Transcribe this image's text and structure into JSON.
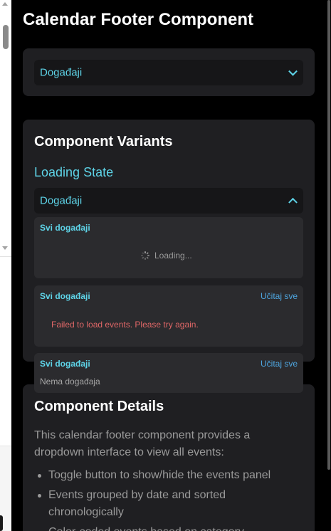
{
  "page": {
    "title": "Calendar Footer Component"
  },
  "top_dropdown": {
    "label": "Događaji",
    "icon": "chevron-down-icon"
  },
  "variants": {
    "heading": "Component Variants",
    "loading_state_title": "Loading State",
    "dropdown": {
      "label": "Događaji",
      "icon": "chevron-up-icon"
    },
    "panels": [
      {
        "title": "Svi događaji",
        "state": "loading",
        "loading_text": "Loading..."
      },
      {
        "title": "Svi događaji",
        "state": "error",
        "link": "Učitaj sve",
        "error_text": "Failed to load events. Please try again."
      },
      {
        "title": "Svi događaji",
        "state": "empty",
        "link": "Učitaj sve",
        "empty_text": "Nema događaja"
      }
    ]
  },
  "details": {
    "heading": "Component Details",
    "description": "This calendar footer component provides a dropdown interface to view all events:",
    "bullets": [
      "Toggle button to show/hide the events panel",
      "Events grouped by date and sorted chronologically",
      "Color-coded events based on category"
    ]
  },
  "colors": {
    "background": "#000000",
    "card": "#1f1f22",
    "accent": "#5ed4e8",
    "link": "#4ea6e0",
    "error": "#e06767"
  }
}
